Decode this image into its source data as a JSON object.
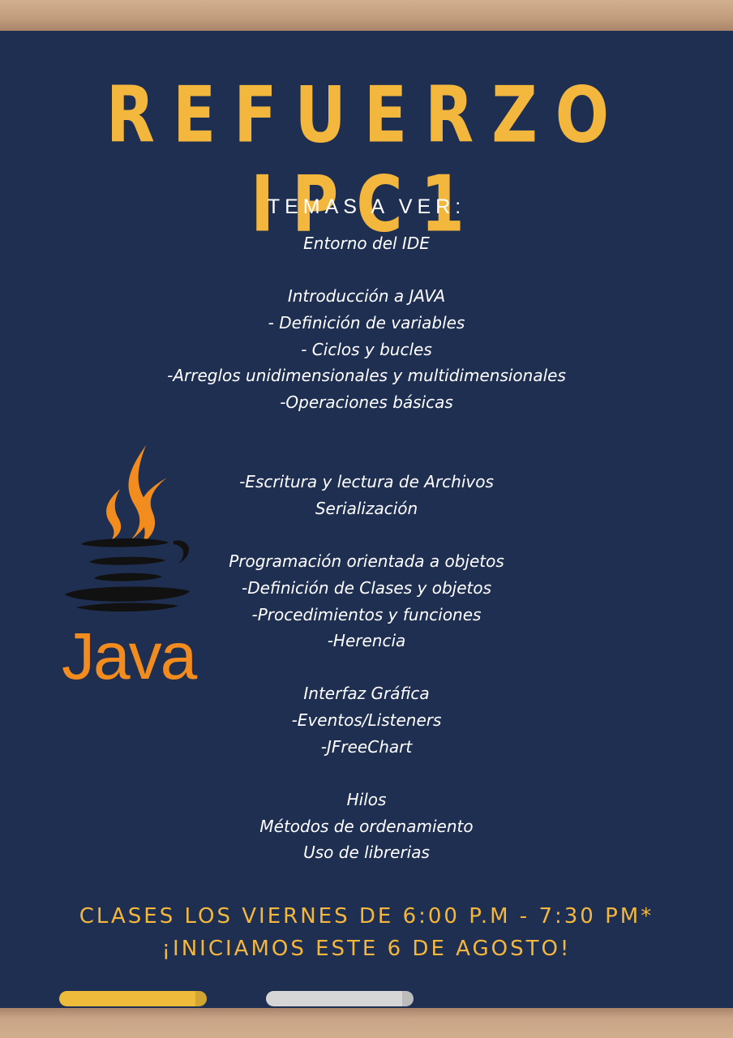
{
  "poster": {
    "title": "REFUERZO IPC1",
    "subtitle": "TEMAS A VER:",
    "topics": [
      "Entorno del IDE",
      "Introducción a JAVA",
      "- Definición de variables",
      "- Ciclos y bucles",
      "-Arreglos unidimensionales y multidimensionales",
      "-Operaciones básicas",
      "-Escritura y lectura de Archivos",
      "Serialización",
      "Programación orientada a objetos",
      "-Definición de Clases y objetos",
      "-Procedimientos y funciones",
      "-Herencia",
      "Interfaz Gráfica",
      "-Eventos/Listeners",
      "-JFreeChart",
      "Hilos",
      "Métodos de ordenamiento",
      "Uso de librerias"
    ],
    "schedule": "CLASES LOS VIERNES DE 6:00 P.M - 7:30 PM*",
    "start": "¡INICIAMOS ESTE 6 DE AGOSTO!",
    "logo": {
      "wordmark": "Java",
      "icon": "java-coffee-cup-icon",
      "color": "#f28c1e"
    }
  },
  "colors": {
    "board": "#1f2f51",
    "accent": "#f4b73e",
    "text": "#ffffff",
    "frame": "#c9a487"
  }
}
